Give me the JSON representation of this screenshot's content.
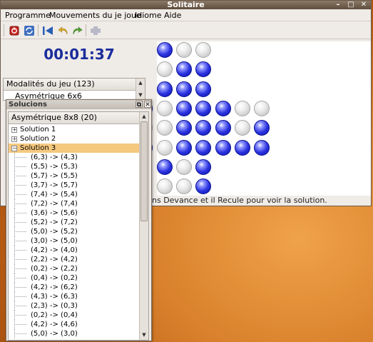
{
  "window": {
    "title": "Solitaire"
  },
  "menu": [
    "Programme",
    "Mouvements du je joue",
    "Idiome",
    "Aide"
  ],
  "toolbar": [
    "stop-icon",
    "refresh-icon",
    "first-move-icon",
    "undo-icon",
    "redo-icon",
    "board-icon"
  ],
  "timer": "00:01:37",
  "modalities": {
    "header": "Modalités du jeu (123)",
    "item": "Asymétrique 6x6"
  },
  "solutions_panel": {
    "title": "Solucions",
    "column": "Asymétrique 8x8 (20)",
    "solutions": [
      "Solution 1",
      "Solution 2",
      "Solution 3"
    ],
    "selected": "Solution 3",
    "moves": [
      "(6,3) -> (4,3)",
      "(5,5) -> (5,3)",
      "(5,7) -> (5,5)",
      "(3,7) -> (5,7)",
      "(7,4) -> (5,4)",
      "(7,2) -> (7,4)",
      "(3,6) -> (5,6)",
      "(5,2) -> (7,2)",
      "(5,0) -> (5,2)",
      "(3,0) -> (5,0)",
      "(4,2) -> (4,0)",
      "(2,2) -> (4,2)",
      "(0,2) -> (2,2)",
      "(0,4) -> (0,2)",
      "(4,2) -> (6,2)",
      "(4,3) -> (6,3)",
      "(2,3) -> (0,3)",
      "(0,2) -> (0,4)",
      "(4,2) -> (4,6)",
      "(5,0) -> (3,0)"
    ]
  },
  "board": {
    "rows": [
      [
        null,
        null,
        1,
        0,
        0,
        null,
        null,
        null
      ],
      [
        null,
        null,
        0,
        1,
        1,
        null,
        null,
        null
      ],
      [
        null,
        null,
        1,
        1,
        1,
        null,
        null,
        null
      ],
      [
        0,
        1,
        0,
        1,
        1,
        1,
        0,
        0
      ],
      [
        1,
        0,
        0,
        1,
        1,
        1,
        0,
        1
      ],
      [
        1,
        1,
        0,
        1,
        1,
        1,
        1,
        1
      ],
      [
        null,
        null,
        1,
        0,
        1,
        null,
        null,
        null
      ],
      [
        null,
        null,
        0,
        0,
        1,
        null,
        null,
        null
      ]
    ],
    "colors": {
      "on": "#2b33e0",
      "off": "#cccccc"
    }
  },
  "status_text": "ns Devance et il Recule pour voir la solution."
}
